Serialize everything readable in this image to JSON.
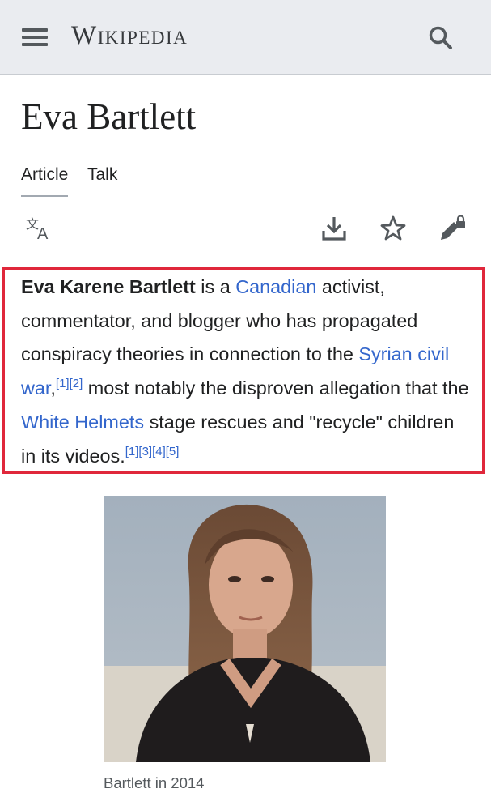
{
  "header": {
    "wordmark": "Wikipedia",
    "menu_icon": "hamburger-menu-icon",
    "search_icon": "search-icon"
  },
  "page": {
    "title": "Eva Bartlett"
  },
  "tabs": [
    {
      "label": "Article",
      "active": true
    },
    {
      "label": "Talk",
      "active": false
    }
  ],
  "toolbar": {
    "language_icon": "language-icon",
    "download_icon": "download-icon",
    "watch_icon": "star-icon",
    "edit_icon": "edit-locked-icon"
  },
  "lead": {
    "subject": "Eva Karene Bartlett",
    "t1": " is a ",
    "link_canadian": "Canadian",
    "t2": " activist, commentator, and blogger who has propagated conspiracy theories in connection to the ",
    "link_syrian_civil_war": "Syrian civil war",
    "t3": ",",
    "refs_1": "[1][2]",
    "t4": " most notably the disproven allegation that the ",
    "link_white_helmets": "White Helmets",
    "t5": " stage rescues and \"recycle\" children in its videos.",
    "refs_2": "[1][3][4][5]"
  },
  "infobox": {
    "caption": "Bartlett in 2014"
  },
  "colors": {
    "link": "#3366cc",
    "highlight_border": "#e0273b",
    "header_bg": "#eaecf0"
  }
}
